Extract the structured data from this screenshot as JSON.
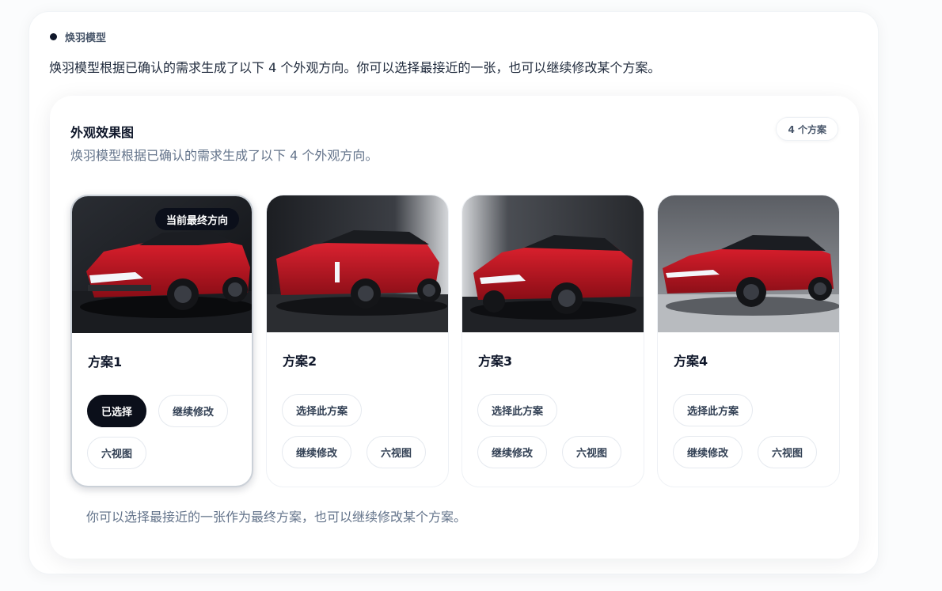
{
  "sender": {
    "name": "焕羽模型"
  },
  "message": {
    "intro": "焕羽模型根据已确认的需求生成了以下 4 个外观方向。你可以选择最接近的一张，也可以继续修改某个方案。"
  },
  "panel": {
    "title": "外观效果图",
    "subtitle": "焕羽模型根据已确认的需求生成了以下 4 个外观方向。",
    "count_badge": "4 个方案",
    "footer_note": "你可以选择最接近的一张作为最终方案，也可以继续修改某个方案。"
  },
  "cards": [
    {
      "title": "方案1",
      "final_tag": "当前最终方向",
      "selected_label": "已选择",
      "edit_label": "继续修改",
      "six_view_label": "六视图",
      "image": "red-suv-concept-render"
    },
    {
      "title": "方案2",
      "select_label": "选择此方案",
      "edit_label": "继续修改",
      "six_view_label": "六视图",
      "image": "red-suv-concept-render"
    },
    {
      "title": "方案3",
      "select_label": "选择此方案",
      "edit_label": "继续修改",
      "six_view_label": "六视图",
      "image": "red-suv-concept-render"
    },
    {
      "title": "方案4",
      "select_label": "选择此方案",
      "edit_label": "继续修改",
      "six_view_label": "六视图",
      "image": "red-suv-concept-render"
    }
  ],
  "colors": {
    "accent_dark": "#0b0f1a",
    "car_red": "#c1121f",
    "muted_text": "#64748b"
  }
}
